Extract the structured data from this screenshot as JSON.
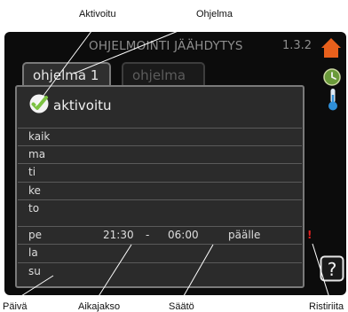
{
  "callouts": {
    "aktivoitu": "Aktivoitu",
    "ohjelma": "Ohjelma",
    "paiva": "Päivä",
    "aikajakso": "Aikajakso",
    "saato": "Säätö",
    "ristiriita": "Ristiriita"
  },
  "header": {
    "title": "OHJELMOINTI JÄÄHDYTYS",
    "version": "1.3.2"
  },
  "tabs": [
    {
      "label": "ohjelma 1",
      "active": true
    },
    {
      "label": "ohjelma 2",
      "active": false
    }
  ],
  "activated": {
    "label": "aktivoitu",
    "checked": true
  },
  "schedule": [
    {
      "day": "kaik",
      "start": "",
      "dash": "",
      "end": "",
      "setting": ""
    },
    {
      "day": "ma",
      "start": "",
      "dash": "",
      "end": "",
      "setting": ""
    },
    {
      "day": "ti",
      "start": "",
      "dash": "",
      "end": "",
      "setting": ""
    },
    {
      "day": "ke",
      "start": "",
      "dash": "",
      "end": "",
      "setting": ""
    },
    {
      "day": "to",
      "start": "",
      "dash": "",
      "end": "",
      "setting": ""
    },
    {
      "day": "pe",
      "start": "21:30",
      "dash": "-",
      "end": "06:00",
      "setting": "päälle"
    },
    {
      "day": "la",
      "start": "",
      "dash": "",
      "end": "",
      "setting": ""
    },
    {
      "day": "su",
      "start": "",
      "dash": "",
      "end": "",
      "setting": ""
    }
  ],
  "conflict": {
    "mark": "!"
  },
  "colors": {
    "home": "#e8601c",
    "clock": "#6a9a3a",
    "thermo": "#2f8fd8",
    "check": "#7cc242",
    "conflict": "#e02020"
  },
  "icons": [
    "home-icon",
    "clock-icon",
    "thermometer-icon",
    "help-icon",
    "checkmark-icon"
  ]
}
